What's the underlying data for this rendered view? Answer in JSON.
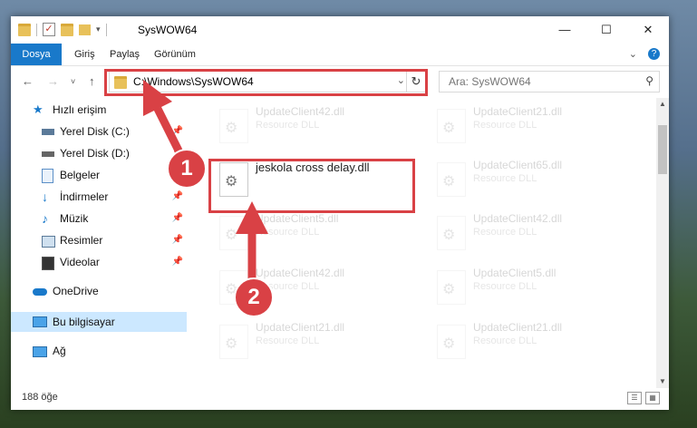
{
  "window": {
    "title": "SysWOW64"
  },
  "ribbon": {
    "tabs": [
      "Dosya",
      "Giriş",
      "Paylaş",
      "Görünüm"
    ]
  },
  "address": {
    "path": "C:\\Windows\\SysWOW64"
  },
  "search": {
    "placeholder": "Ara: SysWOW64"
  },
  "sidebar": {
    "items": [
      {
        "label": "Hızlı erişim",
        "icon": "star-icon"
      },
      {
        "label": "Yerel Disk (C:)",
        "icon": "drive-icon",
        "pinned": true
      },
      {
        "label": "Yerel Disk (D:)",
        "icon": "drive-icon",
        "pinned": true
      },
      {
        "label": "Belgeler",
        "icon": "documents-icon",
        "pinned": true
      },
      {
        "label": "İndirmeler",
        "icon": "downloads-icon",
        "pinned": true
      },
      {
        "label": "Müzik",
        "icon": "music-icon",
        "pinned": true
      },
      {
        "label": "Resimler",
        "icon": "pictures-icon",
        "pinned": true
      },
      {
        "label": "Videolar",
        "icon": "videos-icon",
        "pinned": true
      },
      {
        "label": "OneDrive",
        "icon": "cloud-icon"
      },
      {
        "label": "Bu bilgisayar",
        "icon": "computer-icon",
        "selected": true
      },
      {
        "label": "Ağ",
        "icon": "network-icon"
      }
    ]
  },
  "files": {
    "left": [
      {
        "name": "UpdateClient42.dll",
        "type": "Resource DLL"
      },
      {
        "name": "jeskola cross delay.dll",
        "type": ""
      },
      {
        "name": "UpdateClient5.dll",
        "type": "Resource DLL"
      },
      {
        "name": "UpdateClient42.dll",
        "type": "Resource DLL"
      },
      {
        "name": "UpdateClient21.dll",
        "type": "Resource DLL"
      }
    ],
    "right": [
      {
        "name": "UpdateClient21.dll",
        "type": "Resource DLL"
      },
      {
        "name": "UpdateClient65.dll",
        "type": "Resource DLL"
      },
      {
        "name": "UpdateClient42.dll",
        "type": "Resource DLL"
      },
      {
        "name": "UpdateClient5.dll",
        "type": "Resource DLL"
      },
      {
        "name": "UpdateClient21.dll",
        "type": "Resource DLL"
      }
    ]
  },
  "status": {
    "count": "188 öğe"
  },
  "annotations": {
    "step1": "1",
    "step2": "2"
  },
  "colors": {
    "accent": "#1979ca",
    "highlight": "#d94145",
    "selected": "#cce8ff"
  }
}
